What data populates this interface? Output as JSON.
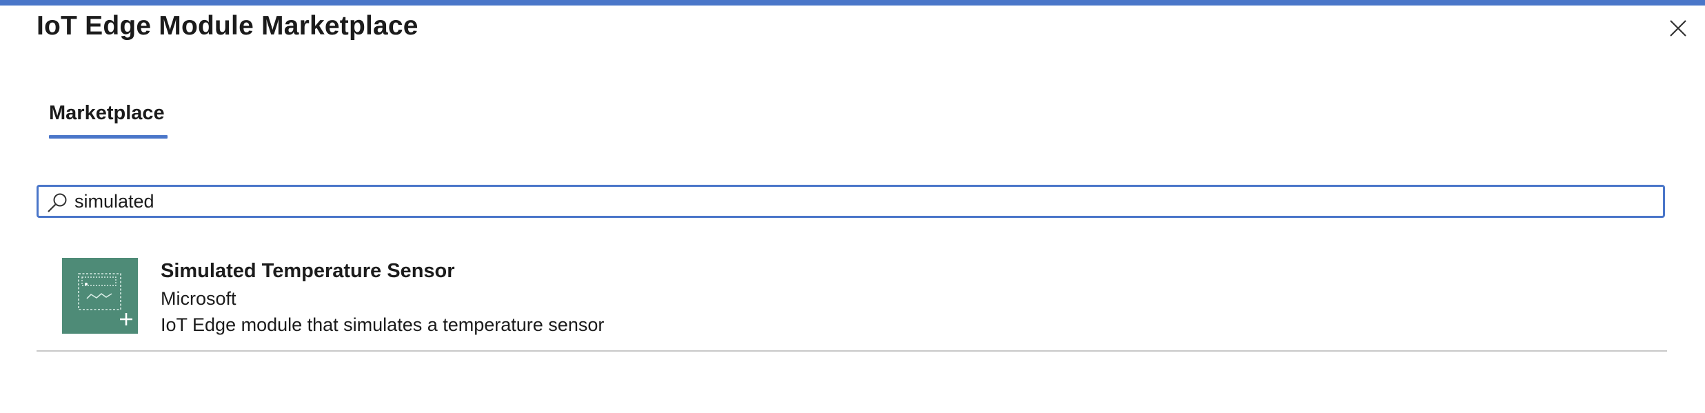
{
  "header": {
    "title": "IoT Edge Module Marketplace",
    "accent_color": "#4a76c9",
    "close_icon": "close-icon"
  },
  "tabs": [
    {
      "label": "Marketplace",
      "selected": true
    }
  ],
  "search": {
    "value": "simulated",
    "placeholder": "",
    "icon": "search-icon"
  },
  "results": [
    {
      "title": "Simulated Temperature Sensor",
      "publisher": "Microsoft",
      "description": "IoT Edge module that simulates a temperature sensor",
      "icon": "module-add-icon",
      "tile_color": "#4e8b77"
    }
  ]
}
